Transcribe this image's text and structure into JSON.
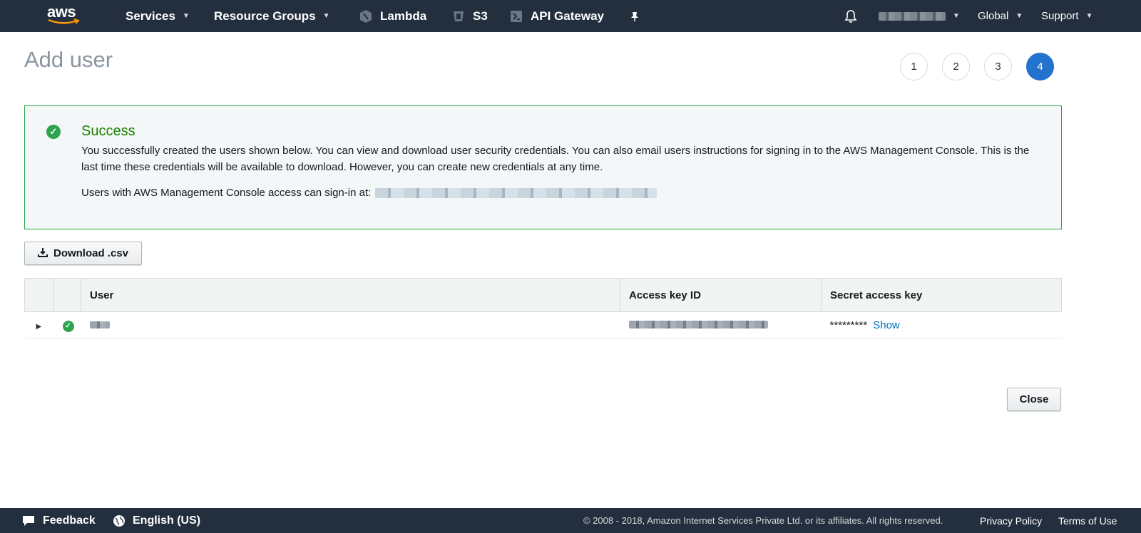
{
  "nav": {
    "logo": "aws",
    "services": "Services",
    "resource_groups": "Resource Groups",
    "shortcuts": [
      {
        "label": "Lambda",
        "icon": "lambda-icon"
      },
      {
        "label": "S3",
        "icon": "s3-icon"
      },
      {
        "label": "API Gateway",
        "icon": "api-gateway-icon"
      }
    ],
    "region": "Global",
    "support": "Support"
  },
  "page": {
    "title": "Add user",
    "steps": [
      "1",
      "2",
      "3",
      "4"
    ],
    "active_step": "4"
  },
  "alert": {
    "title": "Success",
    "body": "You successfully created the users shown below. You can view and download user security credentials. You can also email users instructions for signing in to the AWS Management Console. This is the last time these credentials will be available to download. However, you can create new credentials at any time.",
    "signin_text": "Users with AWS Management Console access can sign-in at:"
  },
  "actions": {
    "download_label": "Download .csv",
    "close_label": "Close"
  },
  "table": {
    "headers": [
      "User",
      "Access key ID",
      "Secret access key"
    ],
    "rows": [
      {
        "secret_masked": "*********",
        "show_label": "Show"
      }
    ]
  },
  "footer": {
    "feedback": "Feedback",
    "language": "English (US)",
    "copyright": "© 2008 - 2018, Amazon Internet Services Private Ltd. or its affiliates. All rights reserved.",
    "privacy": "Privacy Policy",
    "terms": "Terms of Use"
  },
  "colors": {
    "nav_bg": "#232f3e",
    "success_green": "#1d8102",
    "active_step": "#2372cd",
    "link": "#0073bb"
  }
}
